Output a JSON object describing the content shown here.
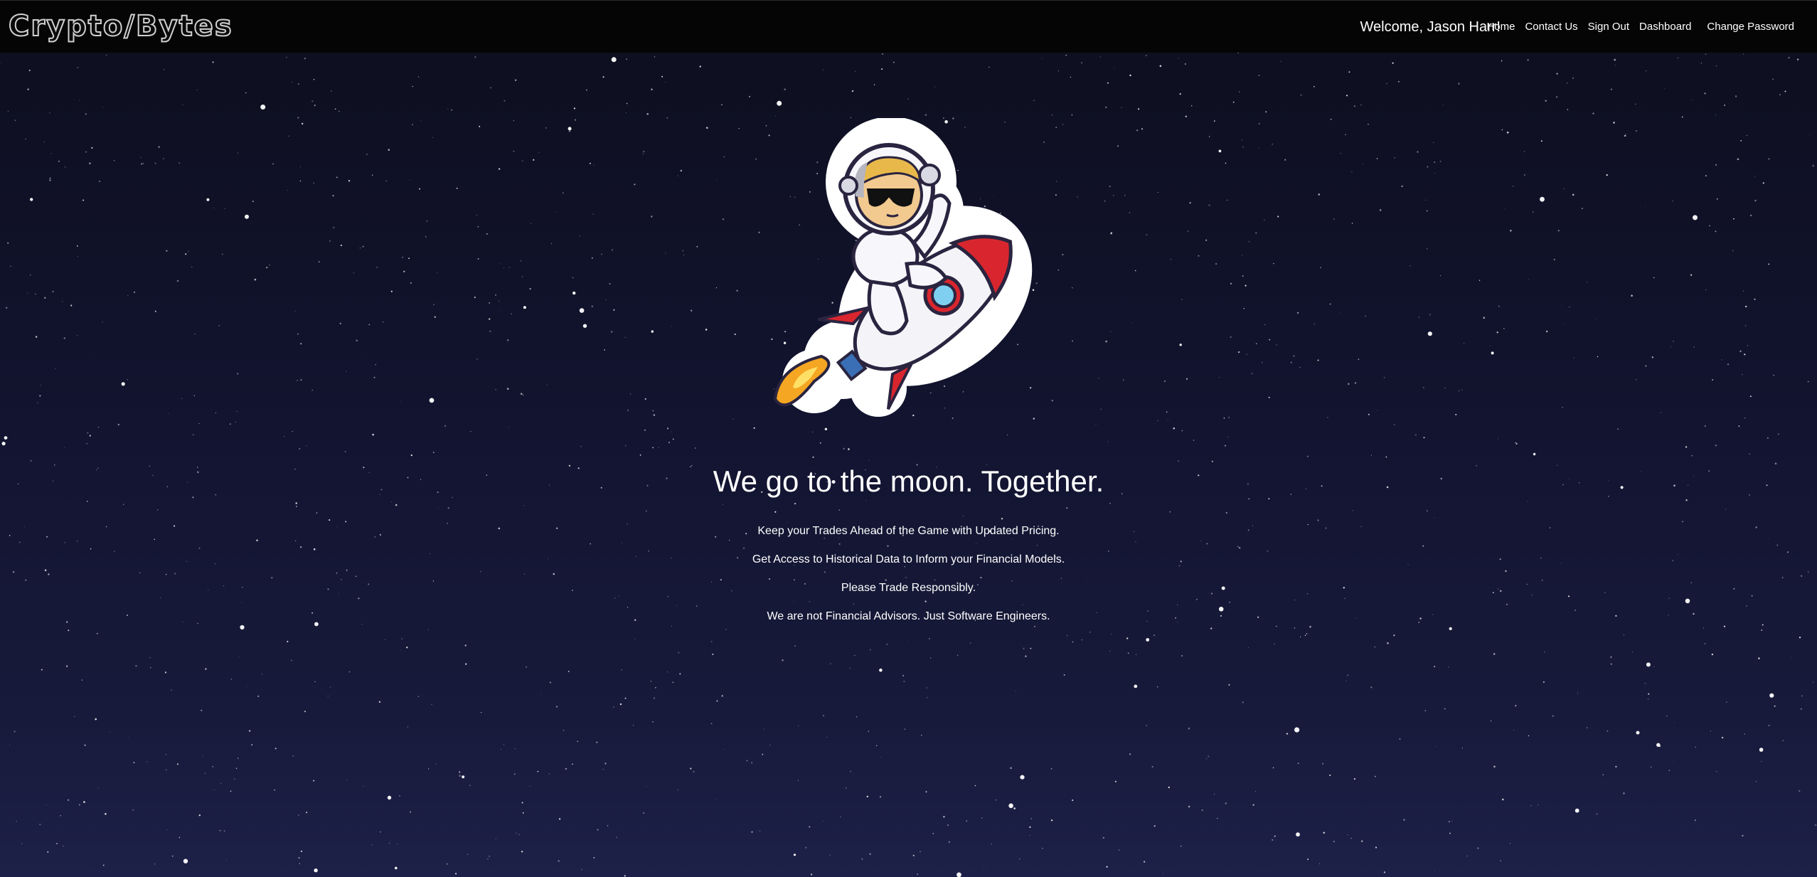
{
  "brand": "Crypto/Bytes",
  "header": {
    "welcome": "Welcome, Jason Harr!",
    "nav": {
      "home": "Home",
      "contact": "Contact Us",
      "signout": "Sign Out",
      "dashboard": "Dashboard",
      "change_password": "Change Password"
    }
  },
  "hero": {
    "mascot_icon": "astronaut-riding-rocket-icon",
    "headline": "We go to the moon. Together.",
    "lines": [
      "Keep your Trades Ahead of the Game with Updated Pricing.",
      "Get Access to Historical Data to Inform your Financial Models.",
      "Please Trade Responsibly.",
      "We are not Financial Advisors. Just Software Engineers."
    ]
  },
  "colors": {
    "topbar": "#050505",
    "space_top": "#0e0f20",
    "space_bottom": "#1d2048",
    "rocket_red": "#d9262e",
    "flame_orange": "#f5a623"
  }
}
